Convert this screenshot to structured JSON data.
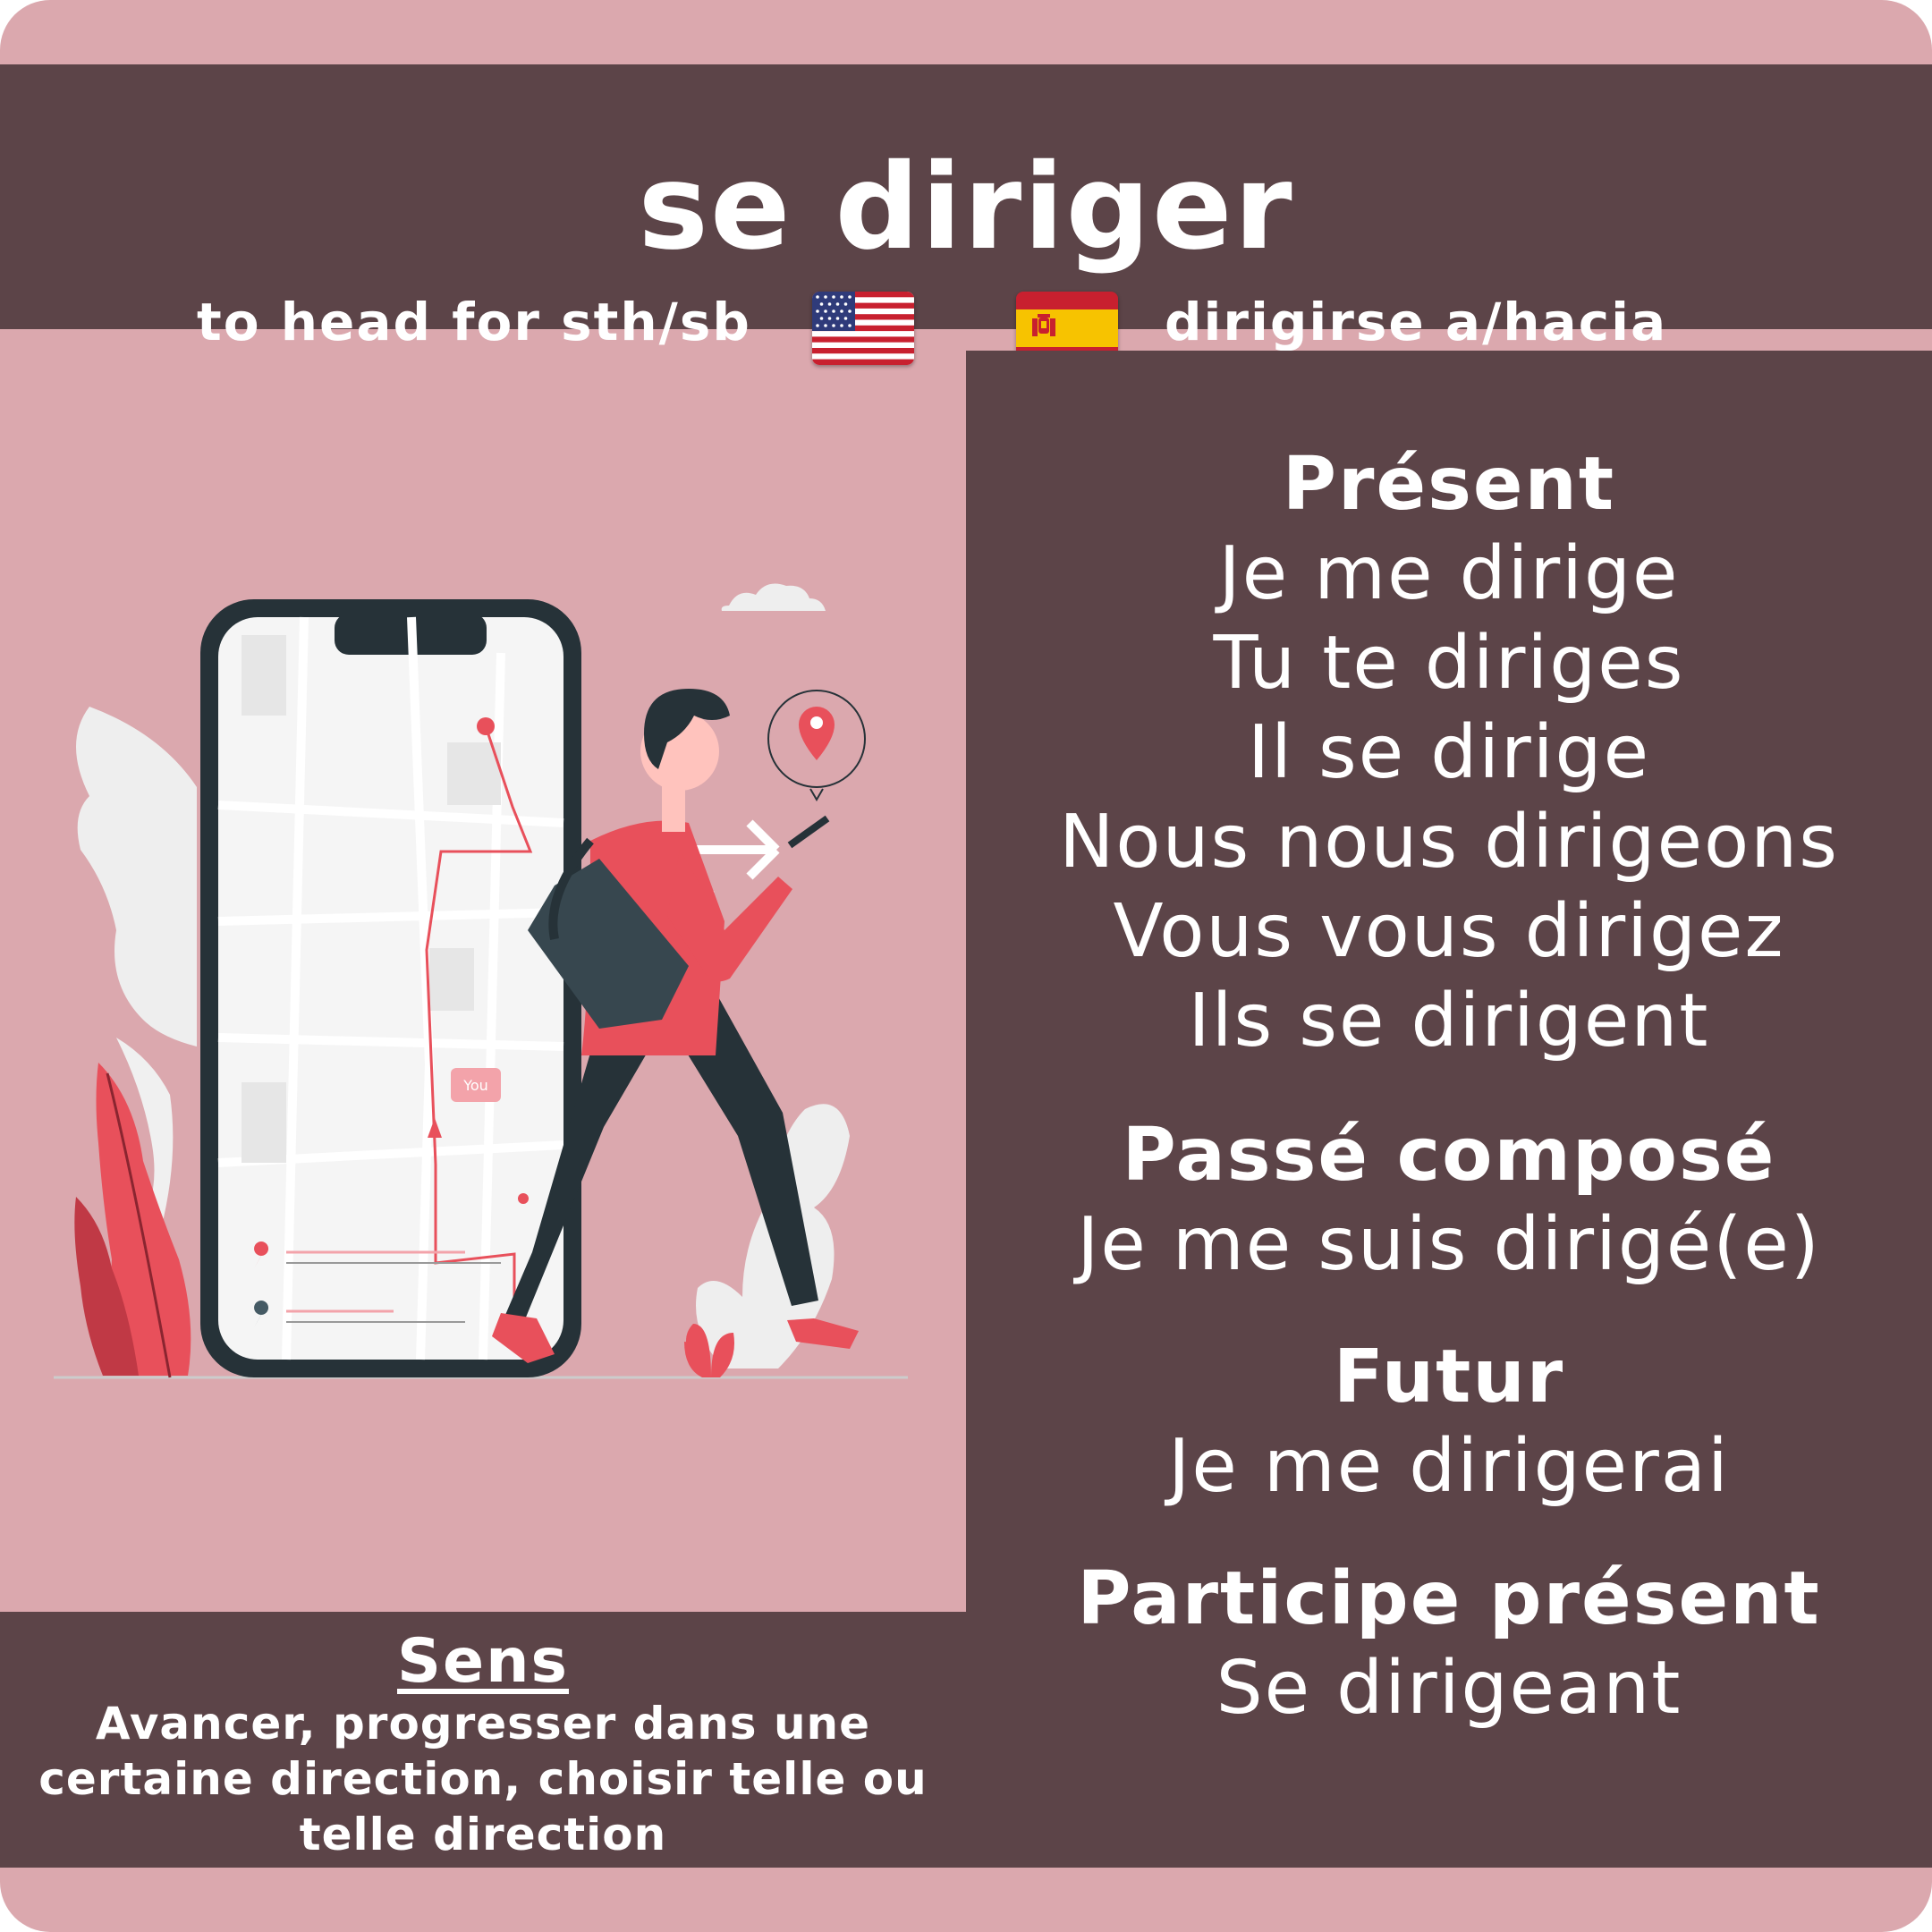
{
  "title": "se diriger",
  "translations": {
    "english": "to head for sth/sb",
    "spanish": "dirigirse a/hacia"
  },
  "flags": {
    "english_icon": "us-flag-icon",
    "spanish_icon": "spain-flag-icon"
  },
  "illustration": {
    "phone_label": "You"
  },
  "sens": {
    "title": "Sens",
    "text": "Avancer, progresser dans une certaine direction, choisir telle ou telle direction"
  },
  "present": {
    "title": "Présent",
    "lines": [
      "Je me dirige",
      "Tu te diriges",
      "Il se dirige",
      "Nous nous dirigeons",
      "Vous vous dirigez",
      "Ils se dirigent"
    ]
  },
  "passe_compose": {
    "title": "Passé composé",
    "lines": [
      "Je me suis dirigé(e)"
    ]
  },
  "futur": {
    "title": "Futur",
    "lines": [
      "Je me dirigerai"
    ]
  },
  "participe_present": {
    "title": "Participe présent",
    "lines": [
      "Se dirigeant"
    ]
  },
  "colors": {
    "background": "#dba8ae",
    "panel": "#5c4448",
    "accent": "#e8505b",
    "dark": "#263238"
  }
}
